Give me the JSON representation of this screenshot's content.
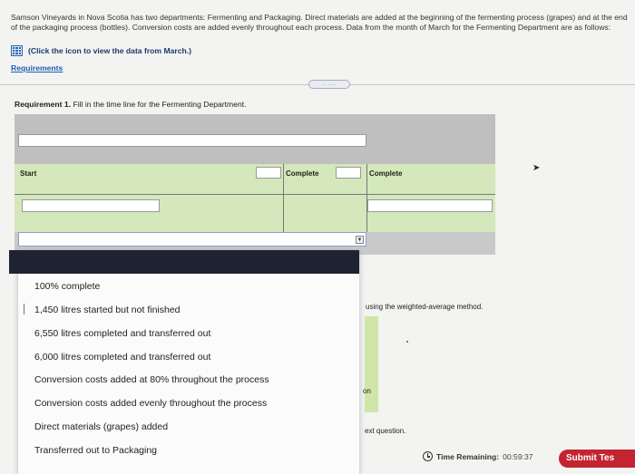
{
  "problem": {
    "text": "Samson Vineyards in Nova Scotia has two departments: Fermenting and Packaging. Direct materials are added at the beginning of the fermenting process (grapes) and at the end of the packaging process (bottles). Conversion costs are added evenly throughout each process. Data from the month of March for the Fermenting Department are as follows:",
    "data_link": "(Click the icon to view the data from March.)",
    "requirements_link": "Requirements",
    "divider_handle": "....."
  },
  "requirement": {
    "label": "Requirement 1.",
    "text": "Fill in the time line for the Fermenting Department."
  },
  "timeline": {
    "start_label": "Start",
    "complete_label_1": "Complete",
    "complete_label_2": "Complete",
    "dropdown_arrow": "▼"
  },
  "dropdown_menu": {
    "items": [
      "100% complete",
      "1,450 litres started but not finished",
      "6,550 litres completed and transferred out",
      "6,000 litres completed and transferred out",
      "Conversion costs added at 80% throughout the process",
      "Conversion costs added evenly throughout the process",
      "Direct materials (grapes) added",
      "Transferred out to Packaging"
    ]
  },
  "partial_text": {
    "method": "using the weighted-average method.",
    "on": "on",
    "next_question": "ext question."
  },
  "footer": {
    "time_label": "Time Remaining:",
    "time_value": "00:59:37",
    "submit_label": "Submit Tes"
  },
  "colors": {
    "green_band": "#d4e8bb",
    "submit": "#c3242f",
    "menu_header": "#1f2230",
    "link": "#1f5fb0"
  }
}
